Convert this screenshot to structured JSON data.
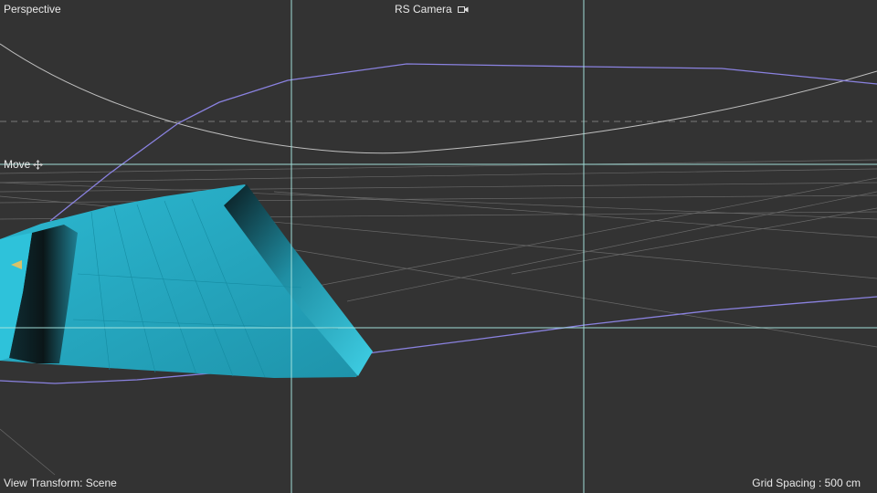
{
  "viewport": {
    "view_name": "Perspective",
    "camera_name": "RS Camera",
    "camera_icon": "camera-icon",
    "active_tool": "Move",
    "tool_icon": "move-icon",
    "view_transform": "View Transform: Scene",
    "grid_spacing": "Grid Spacing : 500 cm"
  },
  "colors": {
    "background": "#333333",
    "safe_frame_lines": "#a8e6e0",
    "spline": "#8a82e0",
    "object_fill": "#29b3cc",
    "grid": "#8a8a8a"
  }
}
